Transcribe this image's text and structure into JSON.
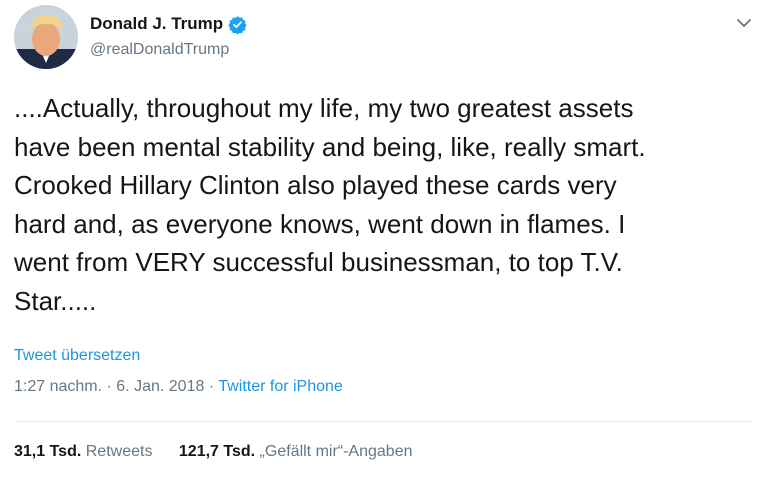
{
  "tweet": {
    "author": {
      "display_name": "Donald J. Trump",
      "handle": "@realDonaldTrump",
      "verified": true,
      "avatar_icon": "profile-photo"
    },
    "text": "....Actually, throughout my life, my two greatest assets\nhave been mental stability and being, like, really smart.\nCrooked Hillary Clinton also played these cards very\nhard and, as everyone knows, went down in flames. I\nwent from VERY successful businessman, to top T.V.\nStar.....",
    "translate_label": "Tweet übersetzen",
    "time": "1:27 nachm.",
    "separator": "·",
    "date": "6. Jan. 2018",
    "source": "Twitter for iPhone",
    "retweets_count": "31,1 Tsd.",
    "retweets_label": "Retweets",
    "likes_count": "121,7 Tsd.",
    "likes_label": "„Gefällt mir“-Angaben"
  },
  "colors": {
    "link": "#1b95e0",
    "muted": "#657786",
    "text": "#14171a",
    "verified_badge": "#1da1f2"
  }
}
